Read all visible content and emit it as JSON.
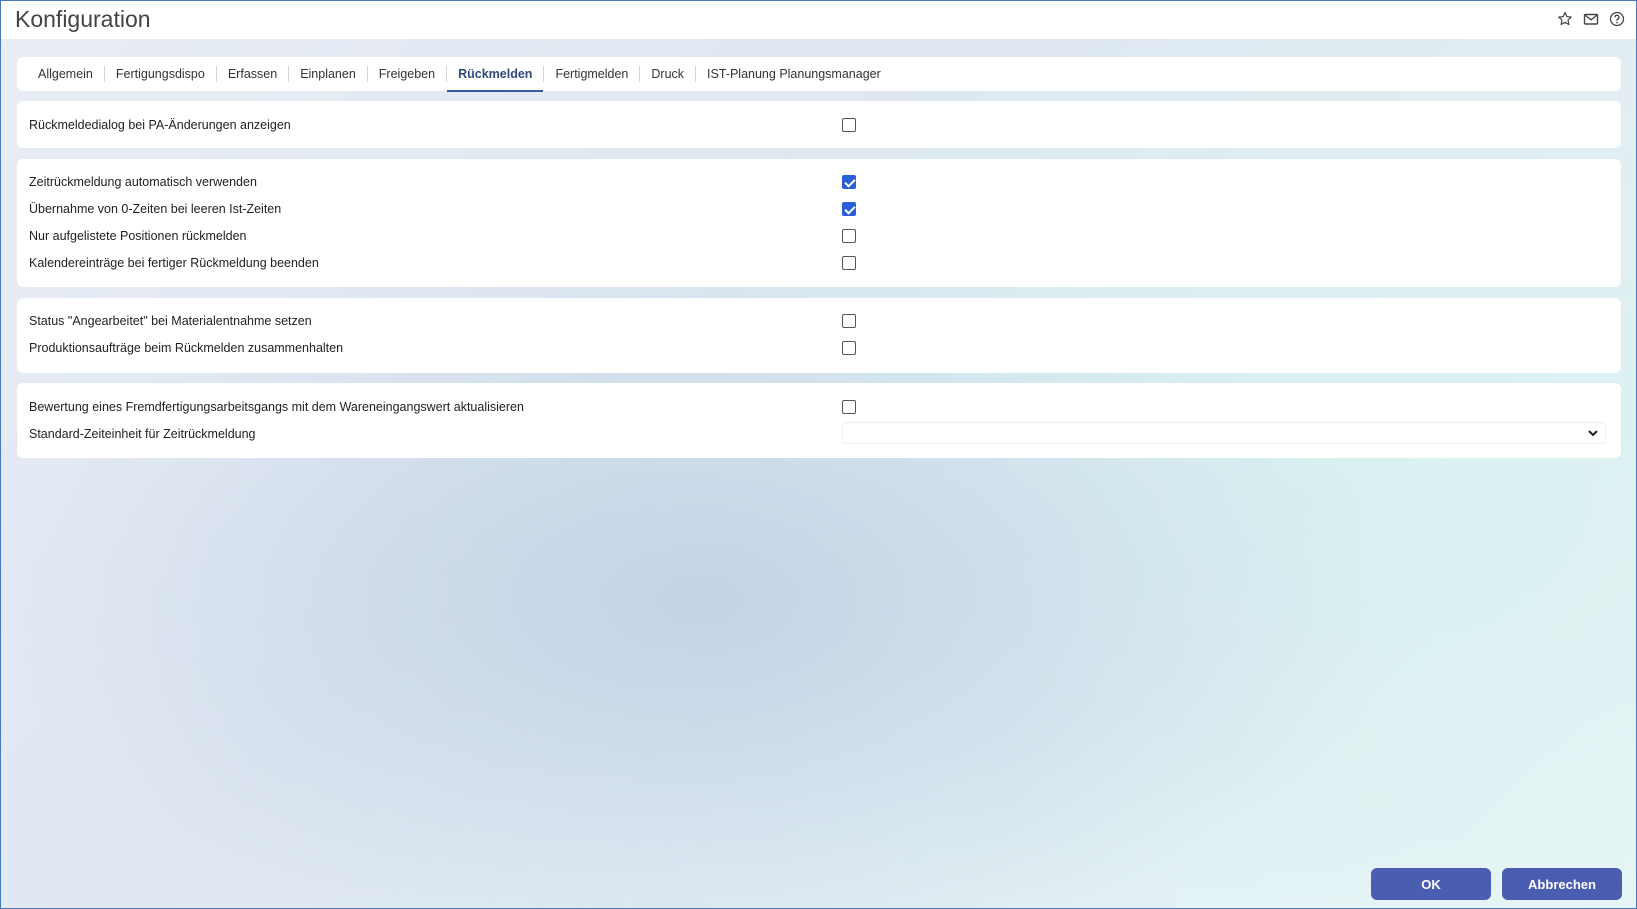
{
  "header": {
    "title": "Konfiguration",
    "icons": [
      "star-icon",
      "mail-icon",
      "help-icon"
    ]
  },
  "tabs": [
    {
      "label": "Allgemein"
    },
    {
      "label": "Fertigungsdispo"
    },
    {
      "label": "Erfassen"
    },
    {
      "label": "Einplanen"
    },
    {
      "label": "Freigeben"
    },
    {
      "label": "Rückmelden",
      "active": true
    },
    {
      "label": "Fertigmelden"
    },
    {
      "label": "Druck"
    },
    {
      "label": "IST-Planung Planungsmanager"
    }
  ],
  "sections": {
    "s1": {
      "r1": {
        "label": "Rückmeldedialog bei PA-Änderungen anzeigen",
        "checked": false
      }
    },
    "s2": {
      "r1": {
        "label": "Zeitrückmeldung automatisch verwenden",
        "checked": true
      },
      "r2": {
        "label": "Übernahme von 0-Zeiten bei leeren Ist-Zeiten",
        "checked": true
      },
      "r3": {
        "label": "Nur aufgelistete Positionen rückmelden",
        "checked": false
      },
      "r4": {
        "label": "Kalendereinträge bei fertiger Rückmeldung beenden",
        "checked": false
      }
    },
    "s3": {
      "r1": {
        "label": "Status \"Angearbeitet\" bei Materialentnahme setzen",
        "checked": false
      },
      "r2": {
        "label": "Produktionsaufträge beim Rückmelden zusammenhalten",
        "checked": false
      }
    },
    "s4": {
      "r1": {
        "label": "Bewertung eines Fremdfertigungsarbeitsgangs mit dem Wareneingangswert aktualisieren",
        "checked": false
      },
      "r2": {
        "label": "Standard-Zeiteinheit für Zeitrückmeldung",
        "value": ""
      }
    }
  },
  "footer": {
    "ok_label": "OK",
    "cancel_label": "Abbrechen"
  },
  "colors": {
    "accent": "#4a5db0",
    "checkbox_checked": "#2b5fd9"
  }
}
